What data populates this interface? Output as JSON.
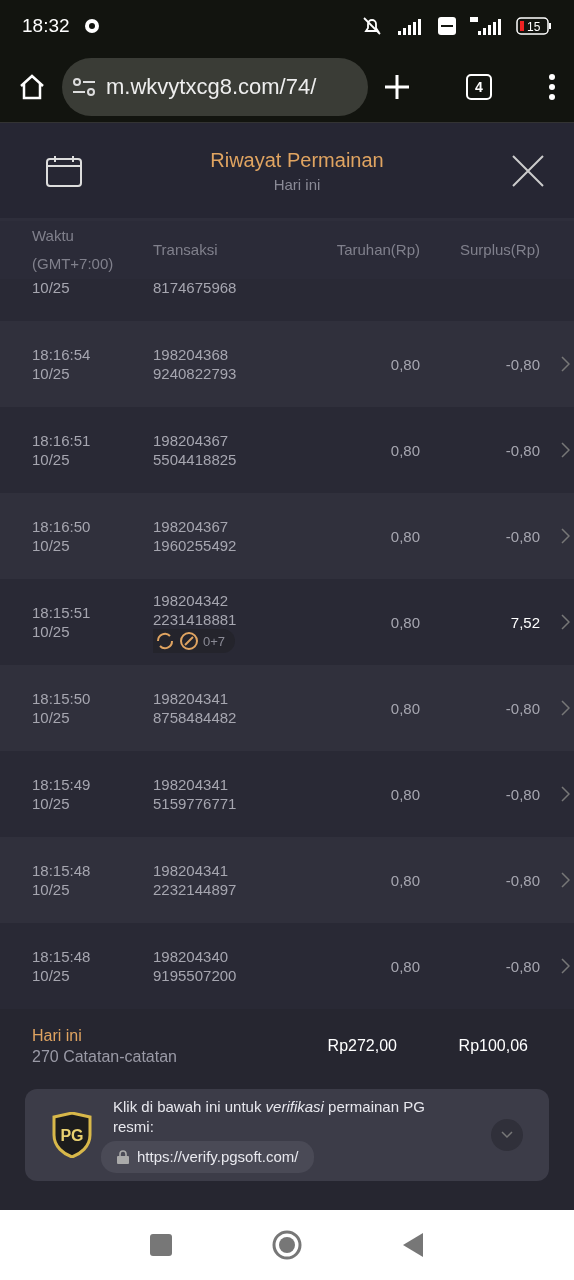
{
  "status_bar": {
    "time": "18:32",
    "battery": "15"
  },
  "browser": {
    "url": "m.wkvytxcg8.com/74/",
    "tab_count": "4"
  },
  "header": {
    "title": "Riwayat Permainan",
    "subtitle": "Hari ini"
  },
  "table": {
    "columns": [
      "Waktu\n(GMT+7:00)",
      "Transaksi",
      "Taruhan(Rp)",
      "Surplus(Rp)"
    ],
    "rows": [
      {
        "kind": "partial",
        "date": "10/25",
        "txn_2": "8174675968"
      },
      {
        "kind": "full",
        "time": "18:16:54",
        "date": "10/25",
        "txn_1": "198204368",
        "txn_2": "9240822793",
        "bet": "0,80",
        "surplus": "-0,80",
        "win": false
      },
      {
        "kind": "full",
        "time": "18:16:51",
        "date": "10/25",
        "txn_1": "198204367",
        "txn_2": "5504418825",
        "bet": "0,80",
        "surplus": "-0,80",
        "win": false
      },
      {
        "kind": "full",
        "time": "18:16:50",
        "date": "10/25",
        "txn_1": "198204367",
        "txn_2": "1960255492",
        "bet": "0,80",
        "surplus": "-0,80",
        "win": false
      },
      {
        "kind": "full",
        "time": "18:15:51",
        "date": "10/25",
        "txn_1": "198204342",
        "txn_2": "2231418881",
        "bet": "0,80",
        "surplus": "7,52",
        "win": true,
        "badge": "0+7"
      },
      {
        "kind": "full",
        "time": "18:15:50",
        "date": "10/25",
        "txn_1": "198204341",
        "txn_2": "8758484482",
        "bet": "0,80",
        "surplus": "-0,80",
        "win": false
      },
      {
        "kind": "full",
        "time": "18:15:49",
        "date": "10/25",
        "txn_1": "198204341",
        "txn_2": "5159776771",
        "bet": "0,80",
        "surplus": "-0,80",
        "win": false
      },
      {
        "kind": "full",
        "time": "18:15:48",
        "date": "10/25",
        "txn_1": "198204341",
        "txn_2": "2232144897",
        "bet": "0,80",
        "surplus": "-0,80",
        "win": false
      },
      {
        "kind": "full",
        "time": "18:15:48",
        "date": "10/25",
        "txn_1": "198204340",
        "txn_2": "9195507200",
        "bet": "0,80",
        "surplus": "-0,80",
        "win": false
      }
    ]
  },
  "summary": {
    "period": "Hari ini",
    "records": "270 Catatan-catatan",
    "total_bet": "Rp272,00",
    "total_surplus": "Rp100,06"
  },
  "verify": {
    "logo": "PG",
    "text": "Klik di bawah ini untuk *verifikasi* permainan PG resmi:",
    "link": "https://verify.pgsoft.com/"
  }
}
